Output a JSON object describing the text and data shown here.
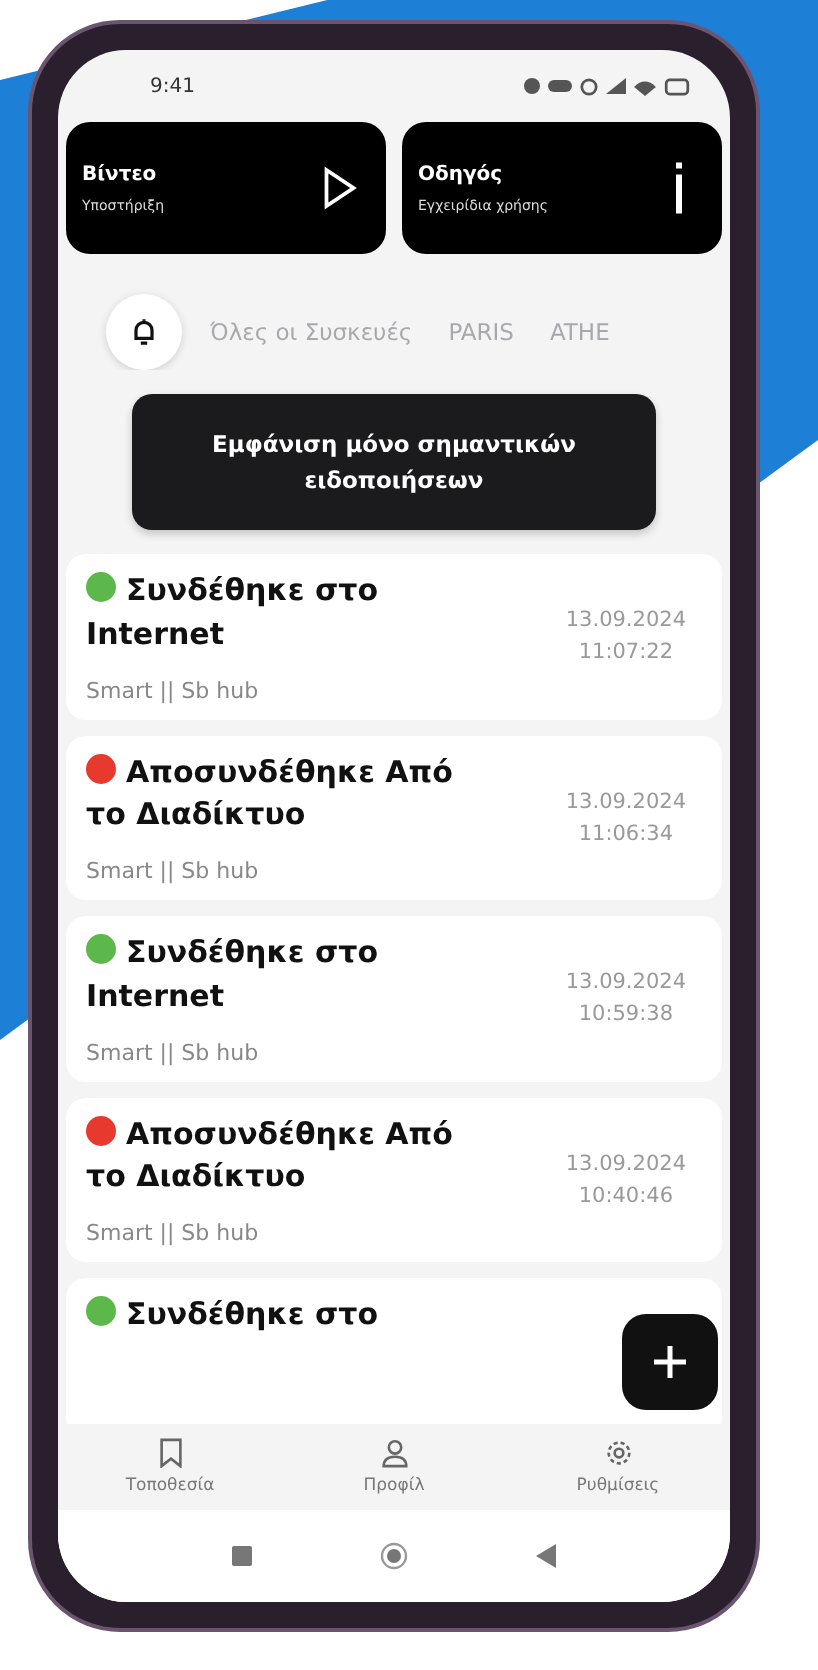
{
  "status_bar": {
    "time": "9:41"
  },
  "quick_cards": [
    {
      "kind": "video",
      "title": "Βίντεο",
      "subtitle": "Υποστήριξη"
    },
    {
      "kind": "guide",
      "title": "Οδηγός",
      "subtitle": "Εγχειρίδια χρήσης"
    }
  ],
  "tabs": [
    {
      "kind": "bell",
      "selected": true
    },
    {
      "kind": "text",
      "label": "Όλες οι Συσκευές",
      "selected": false
    },
    {
      "kind": "text",
      "label": "PARIS",
      "selected": false
    },
    {
      "kind": "text",
      "label": "ATHE",
      "selected": false
    }
  ],
  "filter_button": "Εμφάνιση μόνο σημαντικών ειδοποιήσεων",
  "notifications": [
    {
      "color": "#5cb84a",
      "title": "Συνδέθηκε στο Internet",
      "date": "13.09.2024",
      "time": "11:07:22",
      "device": "Smart || Sb hub"
    },
    {
      "color": "#e8392f",
      "title": "Αποσυνδέθηκε Από το Διαδίκτυο",
      "date": "13.09.2024",
      "time": "11:06:34",
      "device": "Smart || Sb hub"
    },
    {
      "color": "#5cb84a",
      "title": "Συνδέθηκε στο Internet",
      "date": "13.09.2024",
      "time": "10:59:38",
      "device": "Smart || Sb hub"
    },
    {
      "color": "#e8392f",
      "title": "Αποσυνδέθηκε Από το Διαδίκτυο",
      "date": "13.09.2024",
      "time": "10:40:46",
      "device": "Smart || Sb hub"
    },
    {
      "color": "#5cb84a",
      "title": "Συνδέθηκε στο"
    }
  ],
  "bottom_nav": [
    {
      "kind": "bookmark",
      "label": "Τοποθεσία"
    },
    {
      "kind": "person",
      "label": "Προφίλ"
    },
    {
      "kind": "gear",
      "label": "Ρυθμίσεις"
    }
  ]
}
